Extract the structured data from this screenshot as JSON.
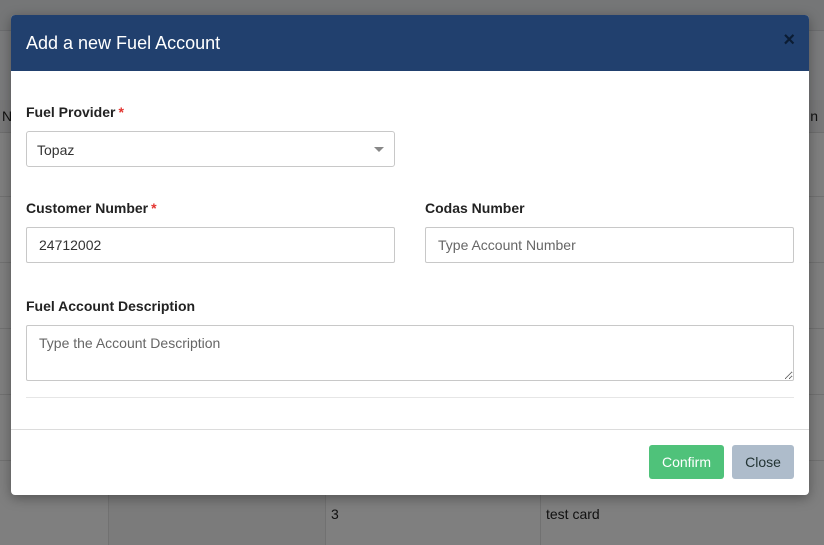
{
  "modal": {
    "title": "Add a new Fuel Account",
    "close_icon": "×"
  },
  "form": {
    "fuel_provider": {
      "label": "Fuel Provider",
      "required_mark": "*",
      "selected": "Topaz"
    },
    "customer_number": {
      "label": "Customer Number",
      "required_mark": "*",
      "value": "24712002"
    },
    "codas_number": {
      "label": "Codas Number",
      "placeholder": "Type Account Number",
      "value": ""
    },
    "description": {
      "label": "Fuel Account Description",
      "placeholder": "Type the Account Description",
      "value": ""
    }
  },
  "buttons": {
    "confirm": "Confirm",
    "close": "Close"
  },
  "background": {
    "header_left": "N",
    "header_right": "n",
    "row_cells": [
      "3",
      "test card"
    ]
  },
  "colors": {
    "header_bg": "#21406e",
    "confirm_bg": "#4fc27a",
    "close_bg": "#aebccb",
    "required": "#e3342f"
  }
}
